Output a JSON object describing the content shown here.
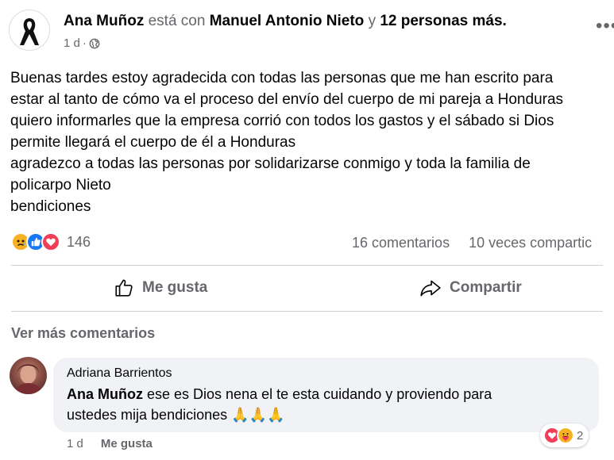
{
  "post": {
    "author": "Ana Muñoz",
    "with_text": "está con",
    "tagged": "Manuel Antonio Nieto",
    "and_text": "y",
    "others": "12 personas más.",
    "time": "1 d",
    "dot": "·",
    "privacy_icon": "globe-icon",
    "more_icon": "•••",
    "lines": [
      "Buenas tardes estoy agradecida con todas las personas que me han escrito para",
      "estar al tanto de cómo va el proceso del envío del cuerpo de mi pareja a Honduras",
      "quiero informarles que la empresa corrió con todos los gastos y el sábado si Dios",
      "permite llegará el cuerpo de él a Honduras",
      "agradezco a todas las personas por solidarizarse conmigo y toda la familia de",
      "policarpo Nieto",
      "bendiciones"
    ]
  },
  "reactions": {
    "icons": [
      "sad-reaction-icon",
      "like-reaction-icon",
      "love-reaction-icon"
    ],
    "count": "146",
    "comments": "16 comentarios",
    "shares": "10 veces compartic"
  },
  "actions": {
    "like": "Me gusta",
    "share": "Compartir"
  },
  "more_comments": "Ver más comentarios",
  "comment": {
    "author": "Adriana Barrientos",
    "mention": "Ana Muñoz",
    "text_1": " ese es Dios nena el te esta cuidando y proviendo para",
    "text_2": "ustedes mija bendiciones ",
    "emojis": "🙏🙏🙏",
    "time": "1 d",
    "like": "Me gusta",
    "reaction_count": "2",
    "reaction_icons": [
      "love-reaction-icon",
      "care-reaction-icon"
    ]
  },
  "colors": {
    "text": "#050505",
    "secondary": "#65676b",
    "like_blue": "#1877f2",
    "love_red": "#f33e58",
    "sad_yellow": "#f7b125",
    "bubble": "#f0f2f5",
    "divider": "#ced0d4"
  }
}
